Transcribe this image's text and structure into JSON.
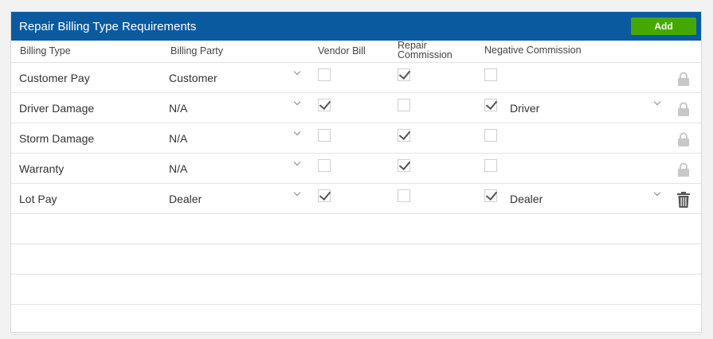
{
  "header": {
    "title": "Repair Billing Type Requirements",
    "add_label": "Add"
  },
  "columns": {
    "billing_type": "Billing Type",
    "billing_party": "Billing Party",
    "vendor_bill": "Vendor Bill",
    "repair_commission": "Repair Commission",
    "negative_commission": "Negative Commission"
  },
  "rows": [
    {
      "billing_type": "Customer Pay",
      "billing_party": "Customer",
      "vendor_bill": false,
      "repair_commission": true,
      "negative_commission": false,
      "negative_party": "",
      "action_icon": "lock-icon"
    },
    {
      "billing_type": "Driver Damage",
      "billing_party": "N/A",
      "vendor_bill": true,
      "repair_commission": false,
      "negative_commission": true,
      "negative_party": "Driver",
      "action_icon": "lock-icon"
    },
    {
      "billing_type": "Storm Damage",
      "billing_party": "N/A",
      "vendor_bill": false,
      "repair_commission": true,
      "negative_commission": false,
      "negative_party": "",
      "action_icon": "lock-icon"
    },
    {
      "billing_type": "Warranty",
      "billing_party": "N/A",
      "vendor_bill": false,
      "repair_commission": true,
      "negative_commission": false,
      "negative_party": "",
      "action_icon": "lock-icon"
    },
    {
      "billing_type": "Lot Pay",
      "billing_party": "Dealer",
      "vendor_bill": true,
      "repair_commission": false,
      "negative_commission": true,
      "negative_party": "Dealer",
      "action_icon": "trash-icon"
    }
  ],
  "colors": {
    "header_bg": "#0a5aa0",
    "add_button": "#45a800"
  }
}
